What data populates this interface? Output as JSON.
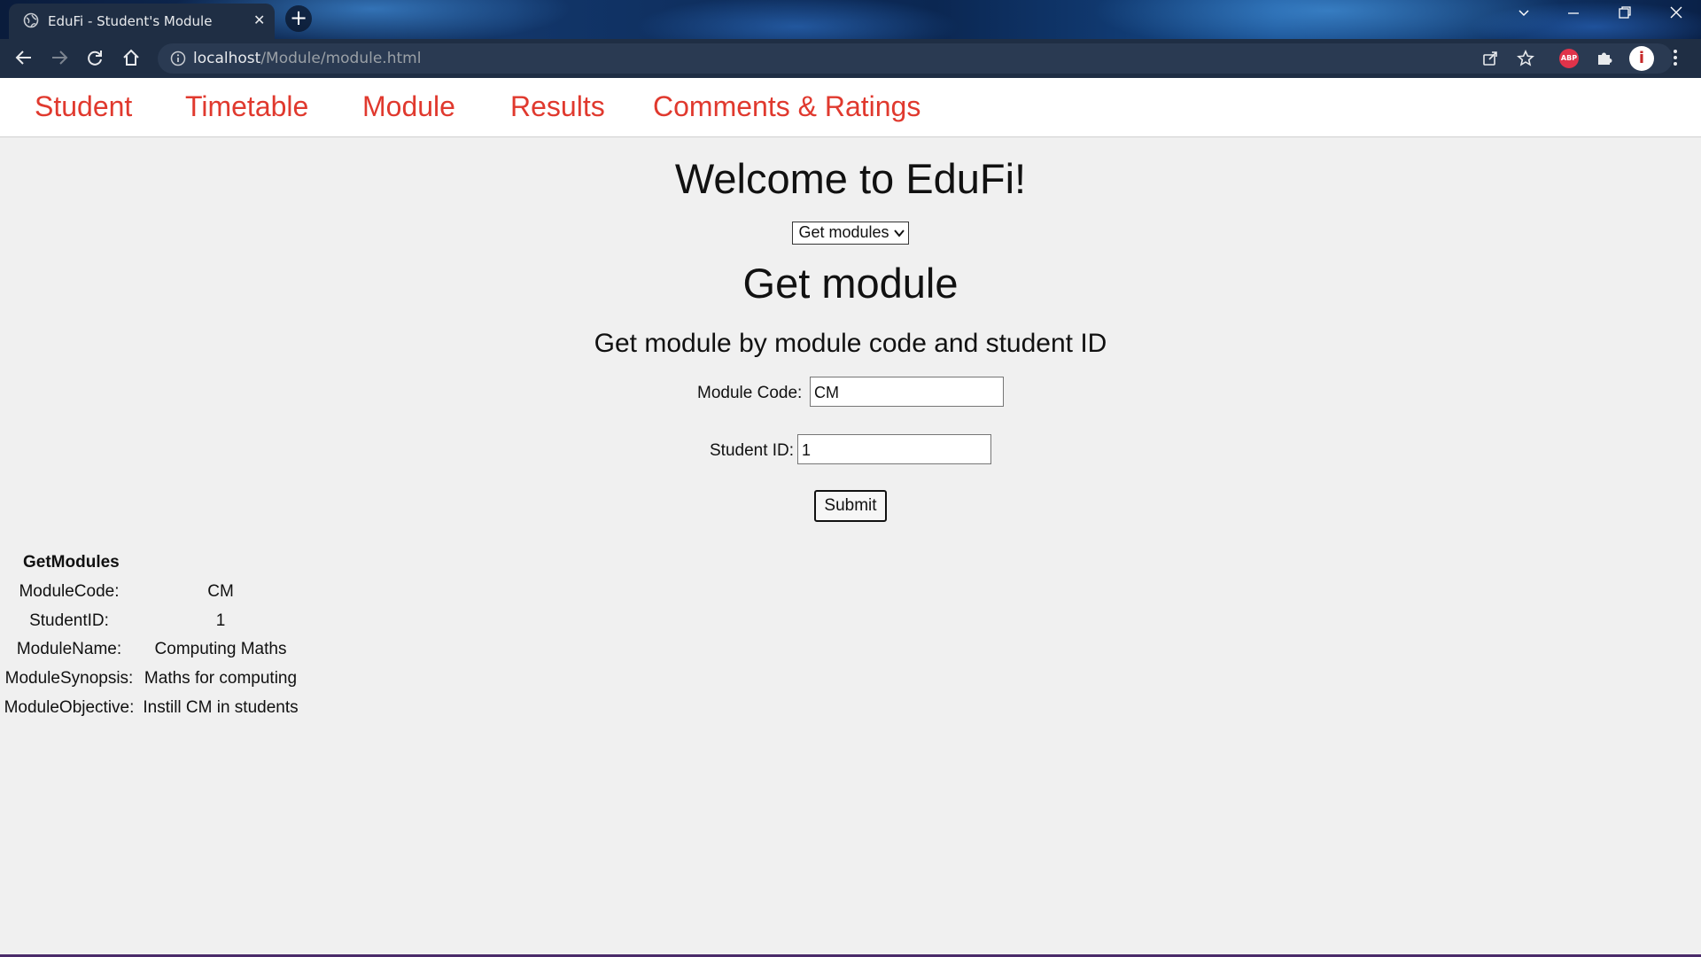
{
  "browser": {
    "tab_title": "EduFi - Student's Module",
    "tab_close": "✕",
    "new_tab": "+",
    "url_host": "localhost",
    "url_path": "/Module/module.html",
    "abp_label": "ABP"
  },
  "nav": {
    "items": [
      "Student",
      "Timetable",
      "Module",
      "Results",
      "Comments & Ratings"
    ],
    "color": "#e0392e"
  },
  "main": {
    "welcome": "Welcome to EduFi!",
    "select_value": "Get modules",
    "heading": "Get module",
    "subheading": "Get module by module code and student ID",
    "module_code_label": "Module Code:",
    "module_code_value": "CM",
    "student_id_label": "Student ID:",
    "student_id_value": "1",
    "submit_label": "Submit"
  },
  "result": {
    "caption": "GetModules",
    "rows": [
      {
        "key": "ModuleCode:",
        "value": "CM"
      },
      {
        "key": "StudentID:",
        "value": "1"
      },
      {
        "key": "ModuleName:",
        "value": "Computing Maths"
      },
      {
        "key": "ModuleSynopsis:",
        "value": "Maths for computing"
      },
      {
        "key": "ModuleObjective:",
        "value": "Instill CM in students"
      }
    ]
  }
}
